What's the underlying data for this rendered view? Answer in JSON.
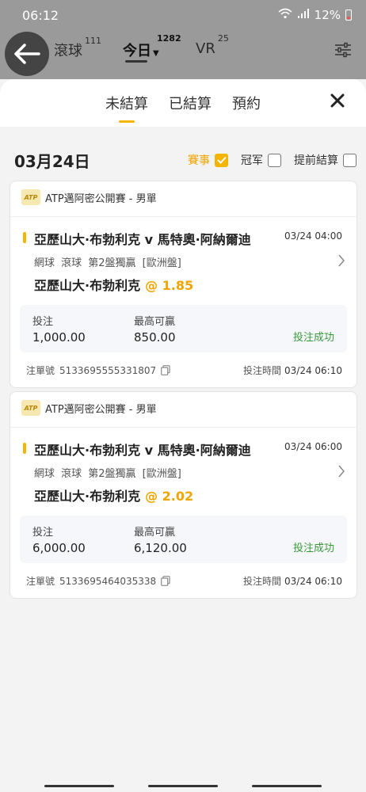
{
  "status": {
    "time": "06:12",
    "battery": "12%"
  },
  "header": {
    "tabs": [
      {
        "label": "滾球",
        "count": "111"
      },
      {
        "label": "今日",
        "count": "1282"
      },
      {
        "label": "VR",
        "count": "25"
      }
    ]
  },
  "sheet": {
    "tabs": [
      "未結算",
      "已結算",
      "預約"
    ],
    "date": "03月24日",
    "filters": [
      {
        "label": "賽事",
        "checked": true
      },
      {
        "label": "冠军",
        "checked": false
      },
      {
        "label": "提前結算",
        "checked": false
      }
    ]
  },
  "bets": [
    {
      "league": "ATP邁阿密公開賽 - 男單",
      "match": "亞歷山大·布勃利克 v 馬特奧·阿納爾迪",
      "match_time": "03/24 04:00",
      "market": "網球 滾球 第2盤獨贏 [歐洲盤]",
      "pick": "亞歷山大·布勃利克",
      "odds": "@ 1.85",
      "stake_label": "投注",
      "stake": "1,000.00",
      "max_win_label": "最高可贏",
      "max_win": "850.00",
      "status": "投注成功",
      "order_label": "注單號",
      "order_no": "5133695555331807",
      "bet_time_label": "投注時間",
      "bet_time": "03/24 06:10"
    },
    {
      "league": "ATP邁阿密公開賽 - 男單",
      "match": "亞歷山大·布勃利克 v 馬特奧·阿納爾迪",
      "match_time": "03/24 06:00",
      "market": "網球 滾球 第2盤獨贏 [歐洲盤]",
      "pick": "亞歷山大·布勃利克",
      "odds": "@ 2.02",
      "stake_label": "投注",
      "stake": "6,000.00",
      "max_win_label": "最高可贏",
      "max_win": "6,120.00",
      "status": "投注成功",
      "order_label": "注單號",
      "order_no": "5133695464035338",
      "bet_time_label": "投注時間",
      "bet_time": "03/24 06:10"
    }
  ]
}
